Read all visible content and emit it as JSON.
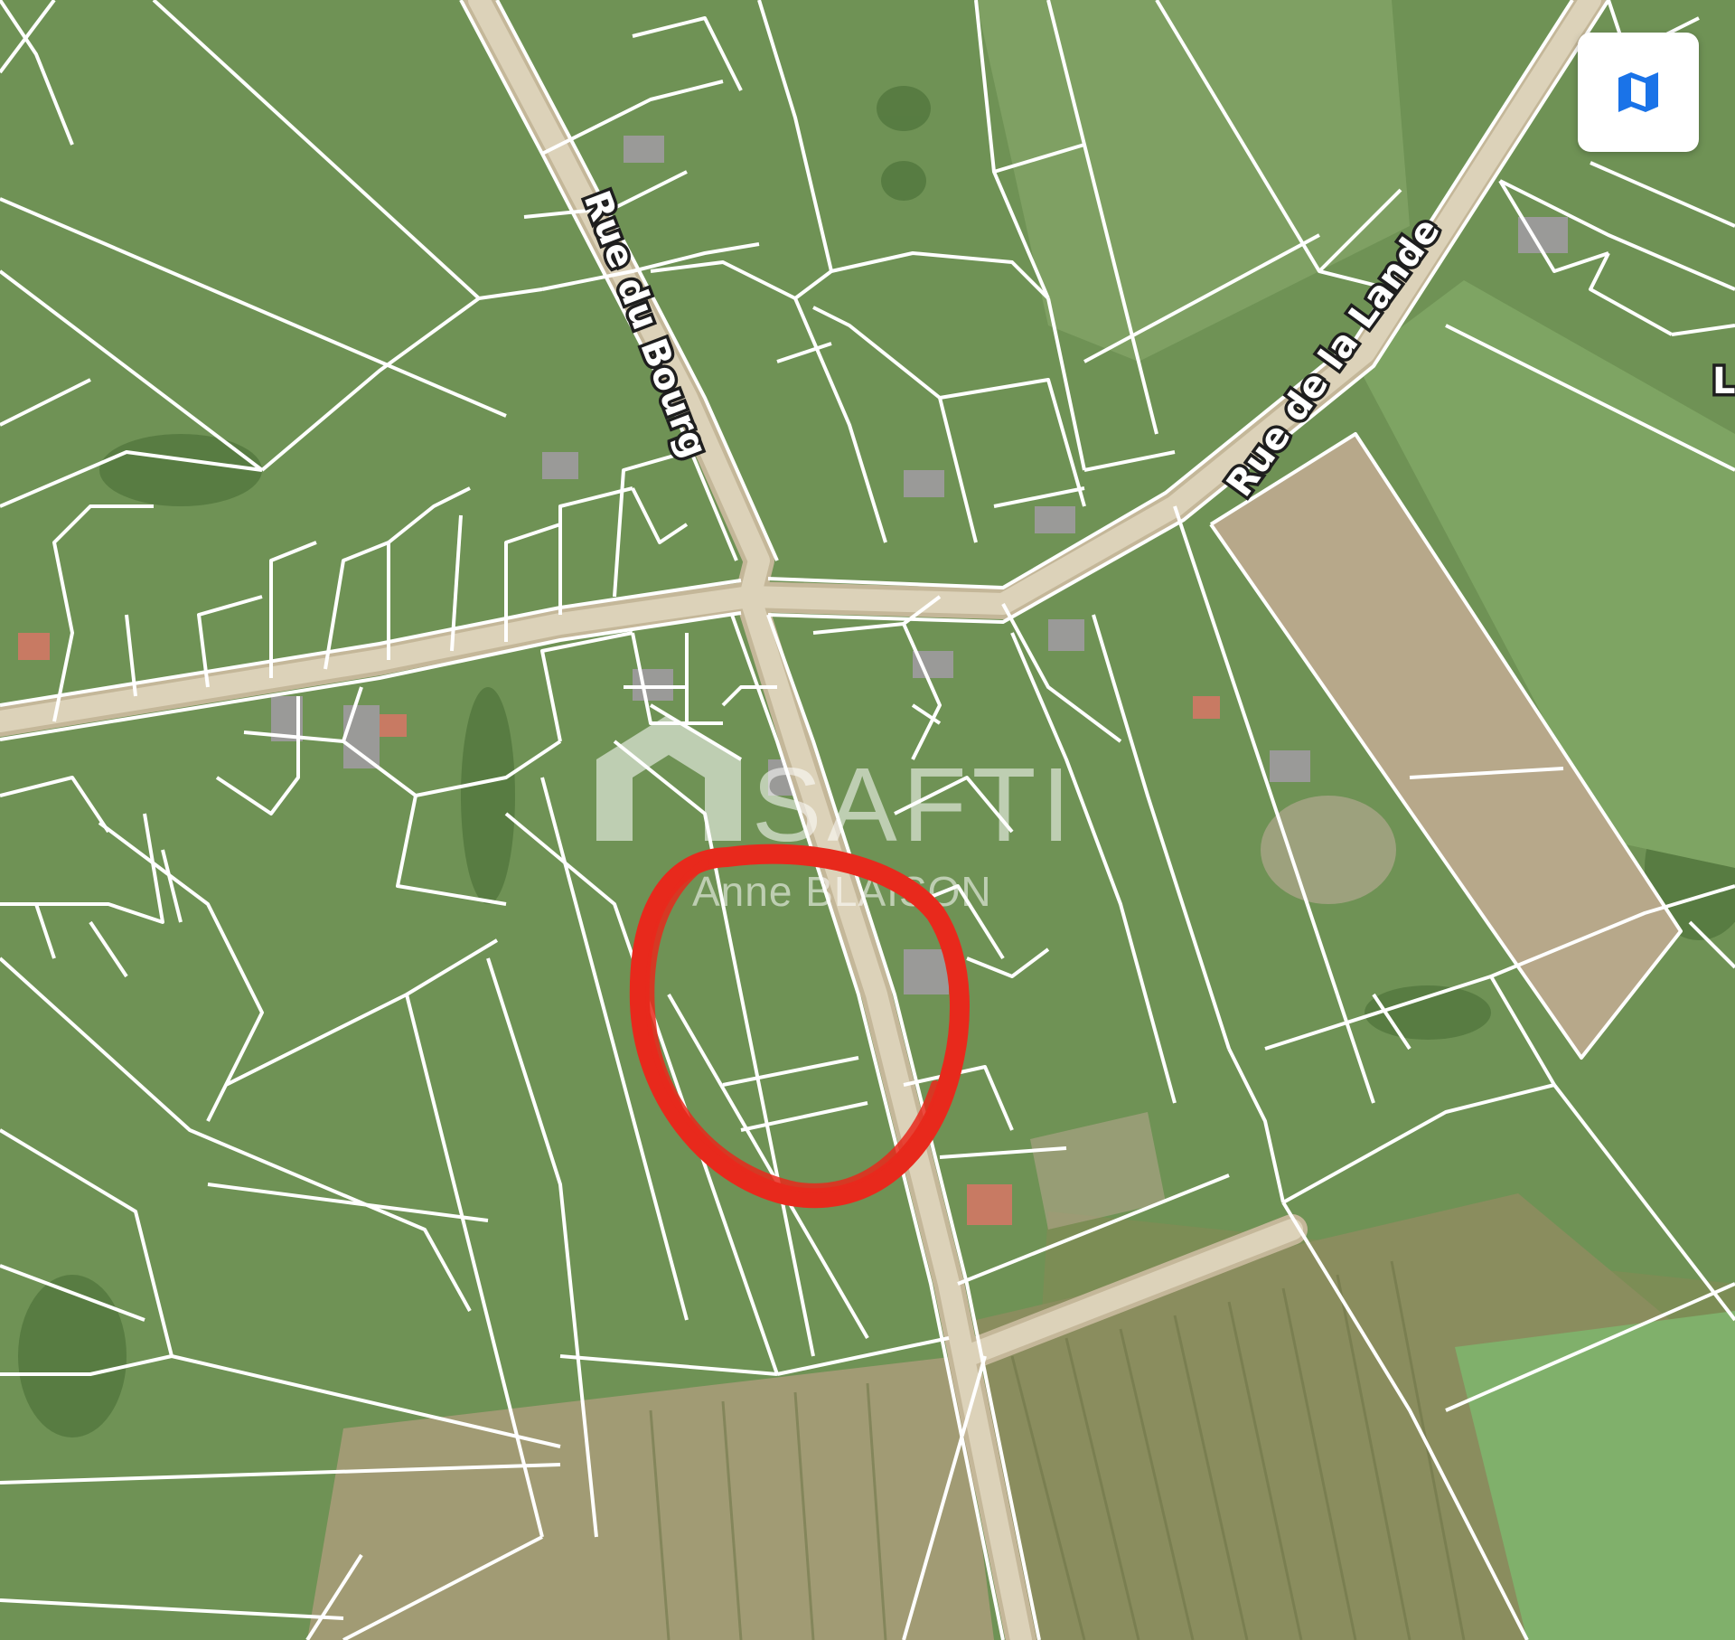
{
  "streets": [
    {
      "id": "rue-du-bourg",
      "name": "Rue du Bourg"
    },
    {
      "id": "rue-de-la-lande",
      "name": "Rue de la Lande"
    },
    {
      "id": "edge-street",
      "name": "L"
    }
  ],
  "watermark": {
    "brand": "SAFTI",
    "agent": "Anne BLAISON"
  },
  "map_controls": {
    "map_mode_icon": "folded-map-icon"
  },
  "highlight": {
    "shape": "hand-drawn-circle",
    "color": "#e8291c"
  },
  "colors": {
    "grass": "#6f9255",
    "grass_dark": "#557a40",
    "road": "#d8ccb0",
    "parcel_line": "#ffffff",
    "button_icon": "#1a73e8"
  }
}
